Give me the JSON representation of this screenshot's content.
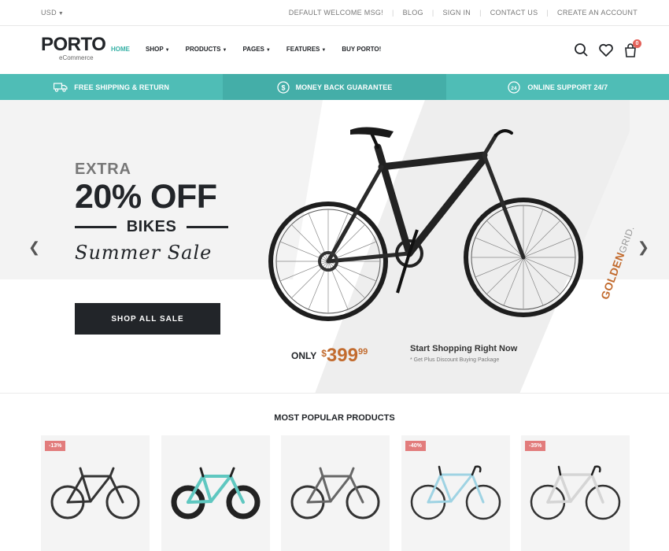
{
  "topbar": {
    "currency": "USD",
    "links": [
      "DEFAULT WELCOME MSG!",
      "BLOG",
      "SIGN IN",
      "CONTACT US",
      "CREATE AN ACCOUNT"
    ]
  },
  "header": {
    "logo": "PORTO",
    "logo_sub": "eCommerce",
    "nav": [
      {
        "label": "HOME",
        "dropdown": false
      },
      {
        "label": "SHOP",
        "dropdown": true
      },
      {
        "label": "PRODUCTS",
        "dropdown": true
      },
      {
        "label": "PAGES",
        "dropdown": true
      },
      {
        "label": "FEATURES",
        "dropdown": true
      },
      {
        "label": "BUY PORTO!",
        "dropdown": false
      }
    ],
    "cart_count": "0"
  },
  "infobar": [
    {
      "label": "FREE SHIPPING & RETURN",
      "icon": "truck-icon"
    },
    {
      "label": "MONEY BACK GUARANTEE",
      "icon": "dollar-circle-icon"
    },
    {
      "label": "ONLINE SUPPORT 24/7",
      "icon": "support-24-icon"
    }
  ],
  "hero": {
    "extra": "EXTRA",
    "headline": "20% OFF",
    "subline": "BIKES",
    "script": "Summer Sale",
    "cta": "SHOP ALL SALE",
    "only_label": "ONLY",
    "price_currency": "$",
    "price_int": "399",
    "price_cents": "99",
    "shop_now": "Start Shopping Right Now",
    "shop_now_sub": "* Get Plus Discount Buying Package",
    "brand_main": "GOLDEN",
    "brand_sub": "GRID."
  },
  "products_section": {
    "title": "MOST POPULAR PRODUCTS",
    "items": [
      {
        "badge": "-13%",
        "frame_color": "#333333"
      },
      {
        "badge": "",
        "frame_color": "#5fc7c0"
      },
      {
        "badge": "",
        "frame_color": "#666666"
      },
      {
        "badge": "-40%",
        "frame_color": "#9fd3e3"
      },
      {
        "badge": "-35%",
        "frame_color": "#dddddd"
      }
    ]
  },
  "colors": {
    "accent": "#4fbdb6",
    "badge": "#e27c7c",
    "price": "#c26b2e",
    "dark": "#222529"
  }
}
